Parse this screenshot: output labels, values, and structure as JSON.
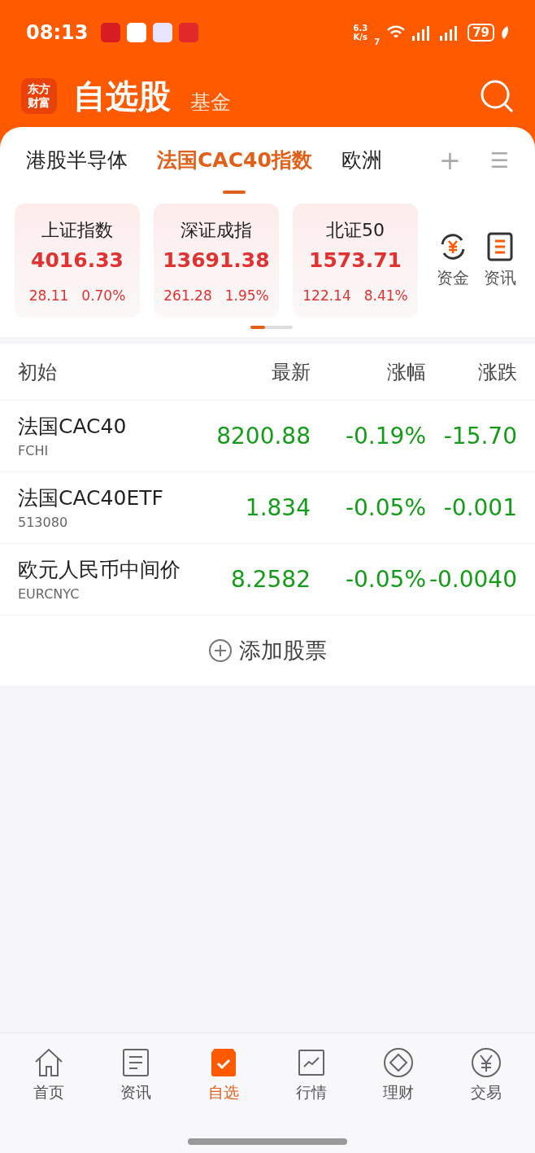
{
  "status_bar": {
    "time": "08:13",
    "net_speed_value": "6.3",
    "net_speed_unit": "K/s",
    "wifi_badge": "7",
    "battery": "79"
  },
  "header": {
    "logo": "东方财富",
    "title": "自选股",
    "subtitle": "基金"
  },
  "tabs": [
    {
      "label": "港股半导体",
      "selected": false
    },
    {
      "label": "法国CAC40指数",
      "selected": true
    },
    {
      "label": "欧洲",
      "selected": false
    }
  ],
  "tab_actions": {
    "add": "+",
    "menu": "☰"
  },
  "indices": [
    {
      "name": "上证指数",
      "value": "4016.33",
      "change": "28.11",
      "percent": "0.70%"
    },
    {
      "name": "深证成指",
      "value": "13691.38",
      "change": "261.28",
      "percent": "1.95%"
    },
    {
      "name": "北证50",
      "value": "1573.71",
      "change": "122.14",
      "percent": "8.41%"
    }
  ],
  "shortcuts": [
    {
      "kind": "funds",
      "label": "资金"
    },
    {
      "kind": "news",
      "label": "资讯"
    }
  ],
  "pager": {
    "level": 0.35
  },
  "table": {
    "columns": [
      "初始",
      "最新",
      "涨幅",
      "涨跌"
    ],
    "rows": [
      {
        "name": "法国CAC40",
        "code": "FCHI",
        "price": "8200.88",
        "percent": "-0.19%",
        "change": "-15.70"
      },
      {
        "name": "法国CAC40ETF",
        "code": "513080",
        "price": "1.834",
        "percent": "-0.05%",
        "change": "-0.001"
      },
      {
        "name": "欧元人民币中间价",
        "code": "EURCNYC",
        "price": "8.2582",
        "percent": "-0.05%",
        "change": "-0.0040"
      }
    ]
  },
  "add_stock": "添加股票",
  "bottom_nav": [
    {
      "kind": "home",
      "label": "首页",
      "selected": false
    },
    {
      "kind": "news",
      "label": "资讯",
      "selected": false
    },
    {
      "kind": "watchlist",
      "label": "自选",
      "selected": true
    },
    {
      "kind": "market",
      "label": "行情",
      "selected": false
    },
    {
      "kind": "wealth",
      "label": "理财",
      "selected": false
    },
    {
      "kind": "trade",
      "label": "交易",
      "selected": false
    }
  ]
}
